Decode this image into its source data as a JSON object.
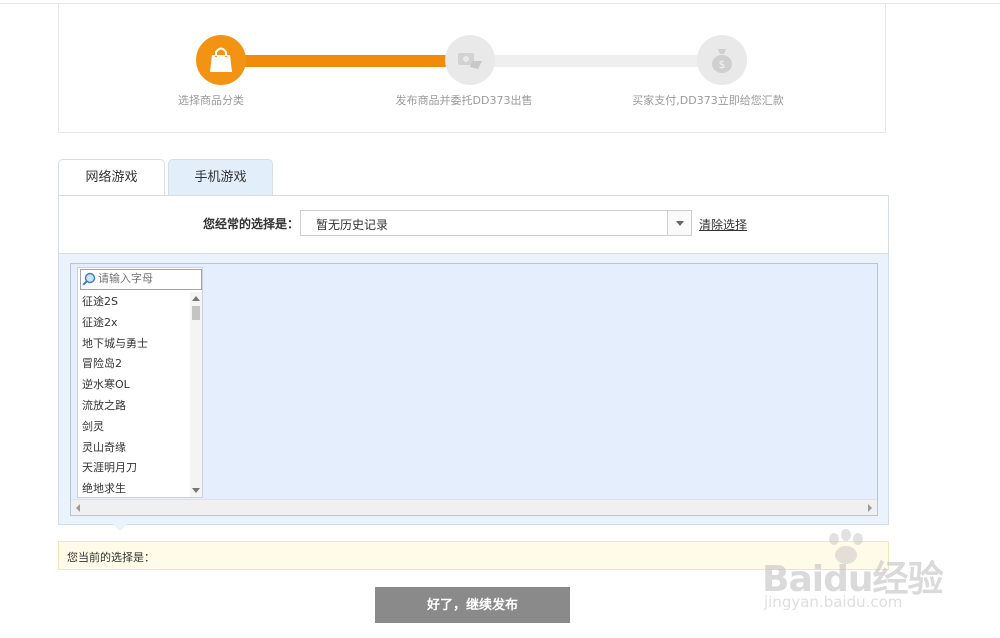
{
  "steps": [
    {
      "label": "选择商品分类",
      "icon": "shopping-bag-icon",
      "active": true
    },
    {
      "label": "发布商品并委托DD373出售",
      "icon": "publish-handshake-icon",
      "active": false
    },
    {
      "label": "买家支付,DD373立即给您汇款",
      "icon": "money-bag-icon",
      "active": false
    }
  ],
  "colors": {
    "accent": "#f28a0b",
    "tab_active_bg": "#e3eefb",
    "button_bg": "#8a8a8a"
  },
  "tabs": [
    {
      "label": "网络游戏",
      "active": false
    },
    {
      "label": "手机游戏",
      "active": true
    }
  ],
  "often": {
    "label": "您经常的选择是：",
    "selected": "暂无历史记录",
    "clear_label": "清除选择"
  },
  "game_list": {
    "search_placeholder": "请输入字母",
    "items": [
      "征途2S",
      "征途2x",
      "地下城与勇士",
      "冒险岛2",
      "逆水寒OL",
      "流放之路",
      "剑灵",
      "灵山奇缘",
      "天涯明月刀",
      "绝地求生"
    ]
  },
  "current_selection": {
    "label": "您当前的选择是："
  },
  "continue_button": {
    "label": "好了，继续发布"
  },
  "watermark": {
    "text": "Baidu经验",
    "url": "jingyan.baidu.com"
  }
}
